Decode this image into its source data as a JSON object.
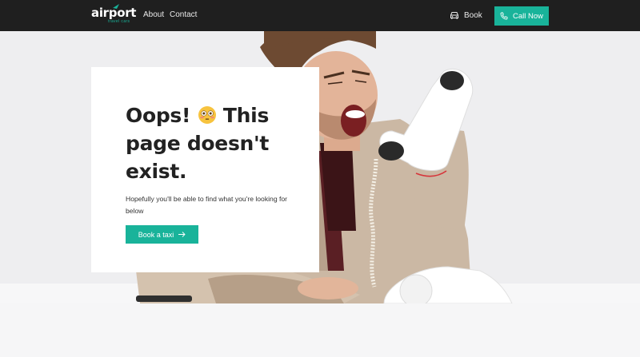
{
  "nav": {
    "logo_text": "airport",
    "logo_subtext": "travel cars",
    "links": [
      "About",
      "Contact"
    ],
    "book_label": "Book",
    "call_label": "Call Now"
  },
  "card": {
    "headline_part1": "Oops!",
    "headline_part2": "This page doesn't exist.",
    "description": "Hopefully you'll be able to find what you're looking for below",
    "cta_label": "Book a taxi"
  },
  "colors": {
    "accent": "#19b39a",
    "nav_bg": "#1f1f1f",
    "text": "#222222"
  },
  "icons": [
    "car-icon",
    "phone-icon",
    "arrow-right-icon",
    "flushed-face-emoji"
  ]
}
